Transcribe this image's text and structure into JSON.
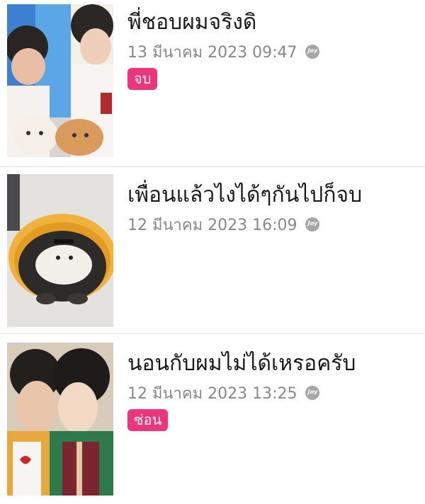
{
  "stories": [
    {
      "title": "พี่ชอบผมจริงดิ",
      "date": "13 มีนาคม 2023 09:47",
      "source_icon": "joy-icon",
      "badge": "จบ"
    },
    {
      "title": "เพื่อนแล้วไงได้ๆกันไปก็จบ",
      "date": "12 มีนาคม 2023 16:09",
      "source_icon": "joy-icon",
      "badge": null
    },
    {
      "title": "นอนกับผมไม่ได้เหรอครับ",
      "date": "12 มีนาคม 2023 13:25",
      "source_icon": "joy-icon",
      "badge": "ซ่อน"
    }
  ],
  "colors": {
    "badge": "#f0347c",
    "meta_text": "#888888",
    "title_text": "#1a1a1a",
    "divider": "#e3e3e3"
  }
}
